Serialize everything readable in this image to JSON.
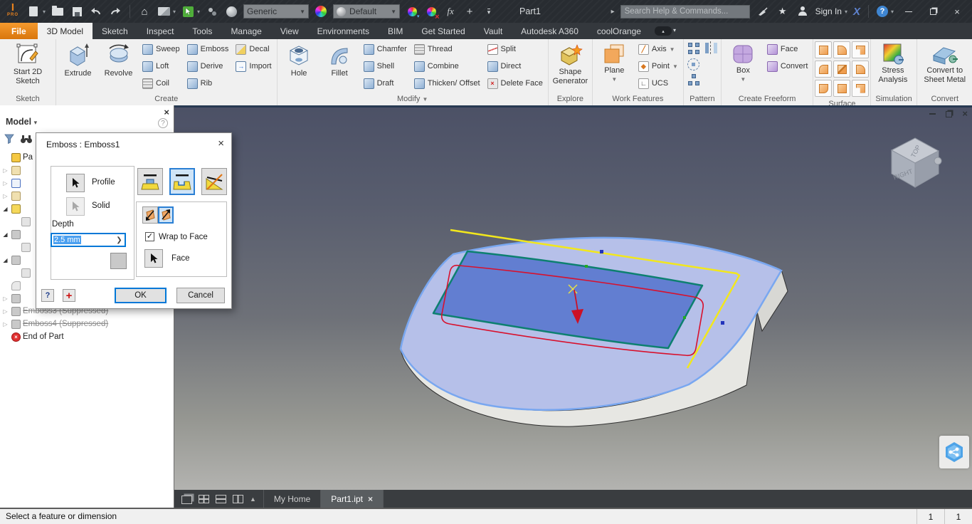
{
  "titlebar": {
    "logo_text": "PRO",
    "document_title": "Part1",
    "material": "Generic",
    "appearance": "Default",
    "fx_label": "fx",
    "search_placeholder": "Search Help & Commands...",
    "sign_in_label": "Sign In"
  },
  "tabs": {
    "file": "File",
    "model3d": "3D Model",
    "sketch": "Sketch",
    "inspect": "Inspect",
    "tools": "Tools",
    "manage": "Manage",
    "view": "View",
    "environments": "Environments",
    "bim": "BIM",
    "get_started": "Get Started",
    "vault": "Vault",
    "a360": "Autodesk A360",
    "coolorange": "coolOrange"
  },
  "ribbon": {
    "sketch": {
      "title": "Sketch",
      "start2d": "Start 2D Sketch"
    },
    "create": {
      "title": "Create",
      "extrude": "Extrude",
      "revolve": "Revolve",
      "sweep": "Sweep",
      "loft": "Loft",
      "coil": "Coil",
      "emboss": "Emboss",
      "derive": "Derive",
      "rib": "Rib",
      "decal": "Decal",
      "import": "Import"
    },
    "modify": {
      "title": "Modify",
      "hole": "Hole",
      "fillet": "Fillet",
      "chamfer": "Chamfer",
      "shell": "Shell",
      "draft": "Draft",
      "thread": "Thread",
      "combine": "Combine",
      "thicken_offset": "Thicken/ Offset",
      "split": "Split",
      "direct": "Direct",
      "delete_face": "Delete Face"
    },
    "explore": {
      "title": "Explore",
      "shape_generator": "Shape Generator"
    },
    "work_features": {
      "title": "Work Features",
      "plane": "Plane",
      "axis": "Axis",
      "point": "Point",
      "ucs": "UCS"
    },
    "pattern": {
      "title": "Pattern"
    },
    "create_freeform": {
      "title": "Create Freeform",
      "box": "Box",
      "face": "Face",
      "convert": "Convert"
    },
    "surface": {
      "title": "Surface"
    },
    "simulation": {
      "title": "Simulation",
      "stress_analysis": "Stress Analysis"
    },
    "convert": {
      "title": "Convert",
      "sheet_metal": "Convert to Sheet Metal"
    }
  },
  "browser": {
    "header": "Model",
    "root_label": "Pa",
    "emboss3": "Emboss3 (Suppressed)",
    "emboss4": "Emboss4 (Suppressed)",
    "end_of_part": "End of Part"
  },
  "dialog": {
    "title": "Emboss : Emboss1",
    "profile_label": "Profile",
    "solid_label": "Solid",
    "depth_label": "Depth",
    "depth_value": "2.5 mm",
    "wrap_label": "Wrap to Face",
    "face_label": "Face",
    "ok_label": "OK",
    "cancel_label": "Cancel"
  },
  "viewcube": {
    "top": "TOP",
    "right": "RIGHT"
  },
  "dock": {
    "home_tab": "My Home",
    "part_tab": "Part1.ipt"
  },
  "statusbar": {
    "message": "Select a feature or dimension",
    "field1": "1",
    "field2": "1"
  },
  "colors": {
    "file_tab_orange": "#e9821e",
    "selection_blue": "#0078d7",
    "top_face": "#b6c0e9",
    "edge_highlight": "#79a7f0",
    "emboss_face_fill": "#4d6dca",
    "profile_outline_teal": "#0d8070",
    "sketch_yellow": "#f2e71c",
    "curve_red": "#d8102c"
  }
}
